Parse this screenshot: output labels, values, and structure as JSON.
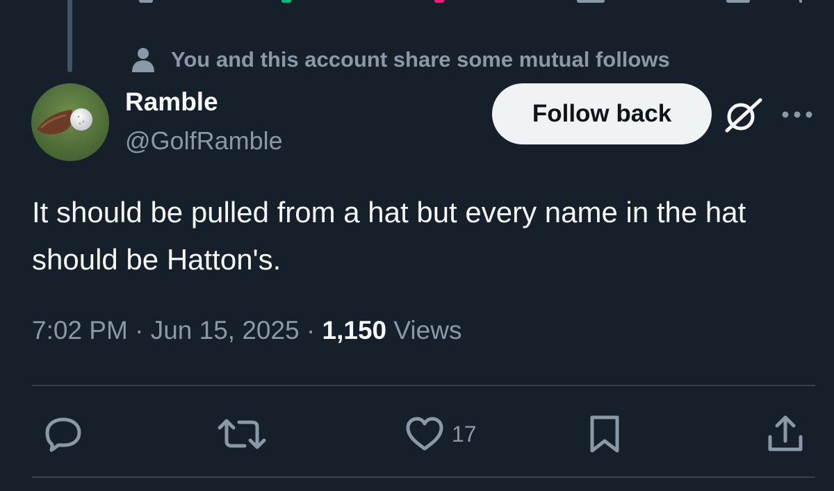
{
  "social_context": {
    "text": "You and this account share some mutual follows",
    "icon": "person-icon"
  },
  "author": {
    "display_name": "Ramble",
    "handle": "@GolfRamble",
    "avatar": "golf-ball-divot-avatar"
  },
  "header_actions": {
    "follow_label": "Follow back",
    "grok_icon": "grok-icon",
    "more_icon": "more-dots-icon"
  },
  "tweet": {
    "text": "It should be pulled from a hat but every name in the hat should be Hatton's.",
    "time": "7:02 PM",
    "separator": "·",
    "date": "Jun 15, 2025",
    "views_count": "1,150",
    "views_label": "Views"
  },
  "actions": {
    "reply_icon": "reply-icon",
    "retweet_icon": "retweet-icon",
    "like_icon": "heart-icon",
    "like_count": "17",
    "bookmark_icon": "bookmark-icon",
    "share_icon": "share-icon"
  },
  "colors": {
    "background": "#15202b",
    "primary_text": "#f7f9f9",
    "secondary_text": "#8b98a5",
    "divider": "#38444d",
    "button_bg": "#eff3f4"
  }
}
